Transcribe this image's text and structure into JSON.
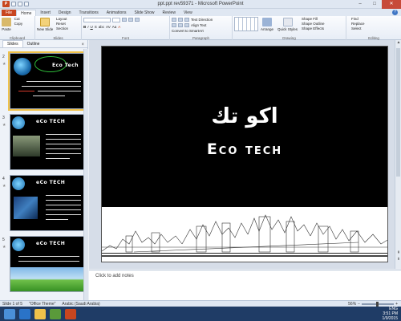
{
  "window": {
    "title": "ppt.ppt rev59371 - Microsoft PowerPoint",
    "app_badge": "P",
    "controls": [
      "–",
      "□",
      "✕"
    ]
  },
  "ribbon_tabs": [
    "File",
    "Home",
    "Insert",
    "Design",
    "Transitions",
    "Animations",
    "Slide Show",
    "Review",
    "View"
  ],
  "ribbon": {
    "groups": [
      {
        "name": "Clipboard",
        "buttons": [
          "Paste",
          "Cut",
          "Copy",
          "Format Painter"
        ]
      },
      {
        "name": "Slides",
        "buttons": [
          "New Slide",
          "Layout",
          "Reset",
          "Section"
        ]
      },
      {
        "name": "Font",
        "buttons": [
          "B",
          "I",
          "U",
          "S",
          "abc",
          "AV",
          "Aa",
          "A"
        ]
      },
      {
        "name": "Paragraph",
        "buttons": [
          "Text Direction",
          "Align Text",
          "Convert to SmartArt"
        ]
      },
      {
        "name": "Drawing",
        "buttons": [
          "Arrange",
          "Quick Styles",
          "Shape Fill",
          "Shape Outline",
          "Shape Effects"
        ]
      },
      {
        "name": "Editing",
        "buttons": [
          "Find",
          "Replace",
          "Select"
        ]
      }
    ]
  },
  "left_panel": {
    "tabs": [
      "Slides",
      "Outline"
    ],
    "close": "×",
    "thumbnails": [
      {
        "number": "2",
        "logo": "Eco Tech",
        "lines": 4
      },
      {
        "number": "3",
        "logo": "eCo TECH",
        "lines": 6
      },
      {
        "number": "4",
        "logo": "eCo TECH",
        "lines": 6
      },
      {
        "number": "5",
        "logo": "eCo TECH",
        "lines": 5
      }
    ]
  },
  "slide": {
    "arabic_title": "اكو تك",
    "english_title": "Eco tech"
  },
  "notes": {
    "placeholder": "Click to add notes"
  },
  "status": {
    "slide_info": "Slide 1 of 5",
    "theme": "\"Office Theme\"",
    "language": "Arabic (Saudi Arabia)",
    "zoom": "56%"
  },
  "taskbar": {
    "time": "3:51 PM",
    "date": "1/9/2015",
    "language_indicator": "ENG"
  },
  "colors": {
    "accent": "#c8461f",
    "slide_bg": "#000000",
    "selection": "#f0c24a",
    "taskbar": "#1f3c66"
  }
}
